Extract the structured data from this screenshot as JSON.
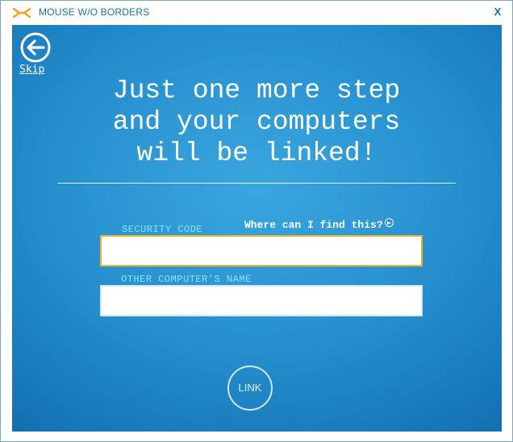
{
  "window": {
    "title": "MOUSE W/O BORDERS",
    "close_label": "X",
    "icon": "mouse-without-borders-icon"
  },
  "nav": {
    "back_icon": "back-arrow-icon",
    "skip_label": "Skip"
  },
  "headline": {
    "line1": "Just one more step",
    "line2": "and your computers",
    "line3": "will be linked!"
  },
  "form": {
    "security_code_label": "SECURITY CODE",
    "security_code_value": "",
    "help_link": "Where can I find this?",
    "help_icon": "arrow-circle-icon",
    "other_computer_label": "OTHER COMPUTER'S NAME",
    "other_computer_value": ""
  },
  "actions": {
    "link_label": "LINK"
  },
  "colors": {
    "panel_blue": "#2690cf",
    "title_blue": "#1a6fb5",
    "label_cyan": "#8fe0ff",
    "focus_border": "#f0b429",
    "icon_orange": "#f5a020"
  }
}
